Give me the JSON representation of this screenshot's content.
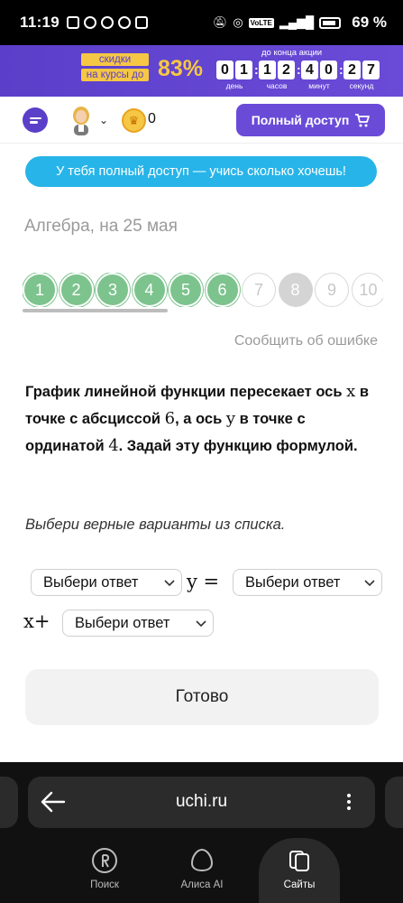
{
  "status_bar": {
    "time": "11:19",
    "battery": "69 %"
  },
  "promo": {
    "tag1": "скидки",
    "tag2": "на курсы до",
    "discount": "83%",
    "until_label": "до конца акции",
    "timer": [
      {
        "digits": [
          "0",
          "1"
        ],
        "label": "день"
      },
      {
        "digits": [
          "1",
          "2"
        ],
        "label": "часов"
      },
      {
        "digits": [
          "4",
          "0"
        ],
        "label": "минут"
      },
      {
        "digits": [
          "2",
          "7"
        ],
        "label": "секунд"
      }
    ]
  },
  "header": {
    "coins": "0",
    "full_access": "Полный доступ"
  },
  "notice": "У тебя полный доступ — учись сколько хочешь!",
  "subject": "Алгебра, на 25 мая",
  "pager": {
    "items": [
      {
        "label": "1",
        "state": "done"
      },
      {
        "label": "2",
        "state": "done"
      },
      {
        "label": "3",
        "state": "done"
      },
      {
        "label": "4",
        "state": "done"
      },
      {
        "label": "5",
        "state": "done"
      },
      {
        "label": "6",
        "state": "done"
      },
      {
        "label": "7",
        "state": "todo"
      },
      {
        "label": "8",
        "state": "current"
      },
      {
        "label": "9",
        "state": "todo"
      },
      {
        "label": "10",
        "state": "todo"
      }
    ]
  },
  "report_error": "Сообщить об ошибке",
  "question": {
    "p1": "График линейной функции пересекает ось ",
    "x": "x",
    "p2": " в точке с абсциссой ",
    "six": "6",
    "p3": ", а ось ",
    "y": "y",
    "p4": " в точке с ординатой ",
    "four": "4",
    "p5": ". Задай эту функцию формулой."
  },
  "instruction": "Выбери верные варианты из списка.",
  "answer": {
    "select1": "Выбери ответ",
    "eq": "y =",
    "select2": "Выбери ответ",
    "xplus": "x+",
    "select3": "Выбери ответ"
  },
  "done_button": "Готово",
  "browser": {
    "url": "uchi.ru",
    "nav": [
      {
        "label": "Поиск",
        "icon": "yandex-search-icon"
      },
      {
        "label": "Алиса AI",
        "icon": "alice-icon"
      },
      {
        "label": "Сайты",
        "icon": "sites-icon"
      }
    ]
  }
}
